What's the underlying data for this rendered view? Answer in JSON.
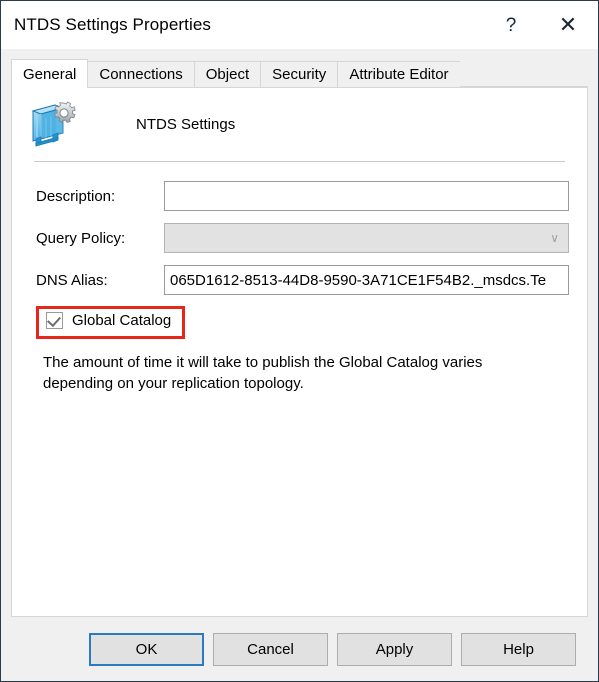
{
  "window": {
    "title": "NTDS Settings Properties",
    "help_icon": "help-question-icon",
    "help_glyph": "?",
    "close_icon": "close-icon",
    "close_glyph": "✕"
  },
  "tabs": [
    {
      "label": "General",
      "active": true
    },
    {
      "label": "Connections",
      "active": false
    },
    {
      "label": "Object",
      "active": false
    },
    {
      "label": "Security",
      "active": false
    },
    {
      "label": "Attribute Editor",
      "active": false
    }
  ],
  "header": {
    "icon": "ntds-settings-server-gear-icon",
    "title": "NTDS Settings"
  },
  "form": {
    "description": {
      "label": "Description:",
      "value": "",
      "placeholder": ""
    },
    "query_policy": {
      "label": "Query Policy:",
      "value": "",
      "chevron_glyph": "∨",
      "enabled": false
    },
    "dns_alias": {
      "label": "DNS Alias:",
      "value": "065D1612-8513-44D8-9590-3A71CE1F54B2._msdcs.Te"
    }
  },
  "global_catalog": {
    "label": "Global Catalog",
    "checked": true,
    "check_glyph": "✓",
    "highlight_color": "#e8271c"
  },
  "note": {
    "text": "The amount of time it will take to publish the Global Catalog varies depending on your replication topology."
  },
  "footer": {
    "buttons": [
      {
        "label": "OK",
        "default": true
      },
      {
        "label": "Cancel",
        "default": false
      },
      {
        "label": "Apply",
        "default": false
      },
      {
        "label": "Help",
        "default": false
      }
    ]
  },
  "colors": {
    "window_border": "#2b3a4a",
    "dialog_bg": "#f0f0f0",
    "page_bg": "#ffffff",
    "accent_focus": "#2c7ac4",
    "annotation_red": "#e8271c"
  }
}
